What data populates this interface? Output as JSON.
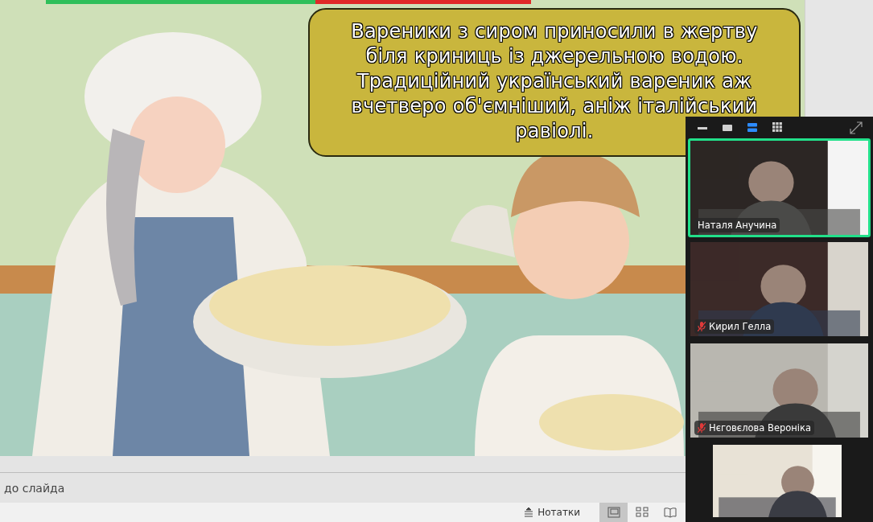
{
  "slide": {
    "caption_lines": [
      "Вареники з сиром приносили в жертву",
      "біля криниць із джерельною водою.",
      "Традиційний український вареник аж",
      "вчетверо об'ємніший, аніж італійський",
      "равіолі."
    ]
  },
  "notes": {
    "text": "до слайда"
  },
  "status_bar": {
    "notes_button": "Нотатки",
    "views": [
      {
        "kind": "normal",
        "selected": true
      },
      {
        "kind": "sorter",
        "selected": false
      },
      {
        "kind": "reading",
        "selected": false
      }
    ]
  },
  "video_panel": {
    "view_modes": [
      {
        "kind": "minimize",
        "selected": false
      },
      {
        "kind": "single",
        "selected": false
      },
      {
        "kind": "speaker",
        "selected": true
      },
      {
        "kind": "gallery",
        "selected": false
      }
    ],
    "participants": [
      {
        "name": "Наталя Анучина",
        "muted": false,
        "active": true
      },
      {
        "name": "Кирил Гелла",
        "muted": true,
        "active": false
      },
      {
        "name": "Нєговєлова Вероніка",
        "muted": true,
        "active": false
      },
      {
        "active": false
      }
    ]
  }
}
